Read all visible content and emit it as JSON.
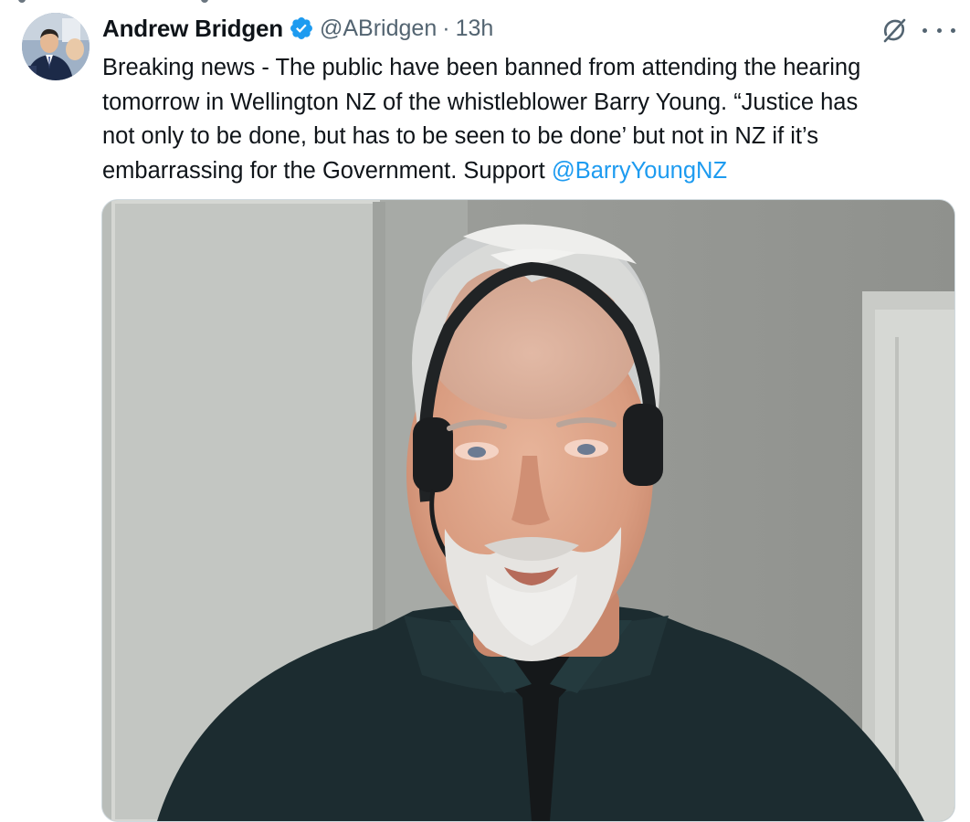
{
  "tweet": {
    "author": {
      "name": "Andrew Bridgen",
      "handle": "@ABridgen",
      "separator": "·",
      "time": "13h",
      "verified": true
    },
    "text_lines": [
      "Breaking news - The public have been banned from attending the hearing",
      "tomorrow in Wellington NZ of the whistleblower Barry Young. “Justice has",
      "not only to be done, but has to be seen to be done’ but not in NZ if it’s",
      "embarrassing for the Government. Support "
    ],
    "mention": "@BarryYoungNZ",
    "icons": {
      "verified": "verified-badge-icon",
      "grok": "grok-icon",
      "more": "more-options-icon"
    },
    "colors": {
      "link": "#1d9bf0",
      "secondary_text": "#536471",
      "primary_text": "#0f1419",
      "verified_badge": "#1d9bf0"
    }
  }
}
